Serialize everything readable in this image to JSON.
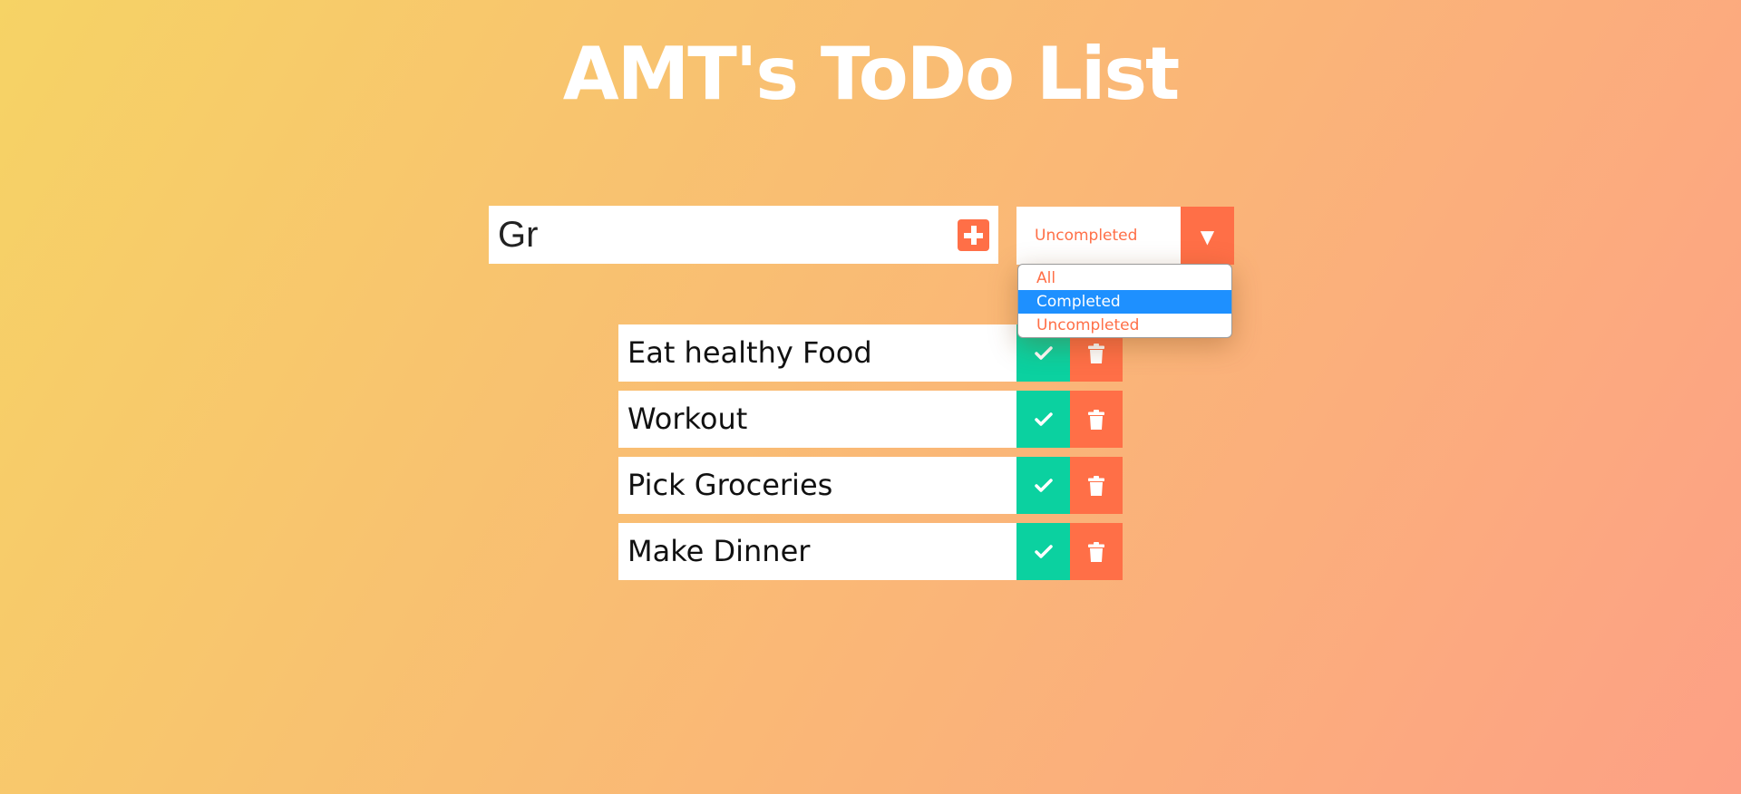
{
  "header": {
    "title": "AMT's ToDo List"
  },
  "form": {
    "input_value": "Gr",
    "add_icon": "plus-square-icon"
  },
  "filter": {
    "selected": "Uncompleted",
    "arrow_icon": "caret-down-icon",
    "options": [
      "All",
      "Completed",
      "Uncompleted"
    ],
    "highlighted": "Completed"
  },
  "todos": [
    {
      "text": "Eat healthy Food"
    },
    {
      "text": "Workout"
    },
    {
      "text": "Pick Groceries"
    },
    {
      "text": "Make Dinner"
    }
  ],
  "colors": {
    "gradient_start": "#f6d365",
    "gradient_end": "#fda085",
    "accent": "#ff6f47",
    "complete": "#0bd1a0",
    "highlight": "#1e90ff"
  },
  "icons": {
    "complete": "check-icon",
    "delete": "trash-icon"
  }
}
